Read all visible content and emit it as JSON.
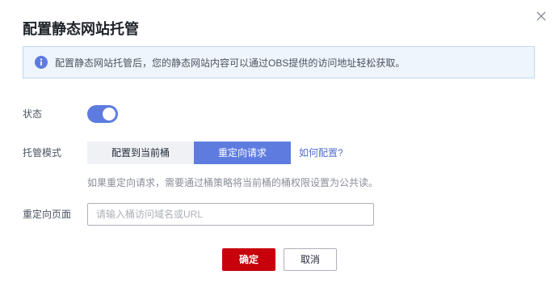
{
  "dialog": {
    "title": "配置静态网站托管",
    "notice": "配置静态网站托管后，您的静态网站内容可以通过OBS提供的访问地址轻松获取。",
    "status": {
      "label": "状态",
      "enabled": true
    },
    "mode": {
      "label": "托管模式",
      "options": [
        "配置到当前桶",
        "重定向请求"
      ],
      "selected": "重定向请求",
      "help_link": "如何配置?",
      "hint": "如果重定向请求，需要通过桶策略将当前桶的桶权限设置为公共读。"
    },
    "redirect_page": {
      "label": "重定向页面",
      "placeholder": "请输入桶访问域名或URL",
      "value": ""
    },
    "buttons": {
      "ok": "确定",
      "cancel": "取消"
    }
  },
  "colors": {
    "primary": "#5e7ce0",
    "danger": "#c7000b",
    "link": "#526ecc"
  },
  "icons": {
    "close": "close-icon",
    "info": "info-icon"
  }
}
